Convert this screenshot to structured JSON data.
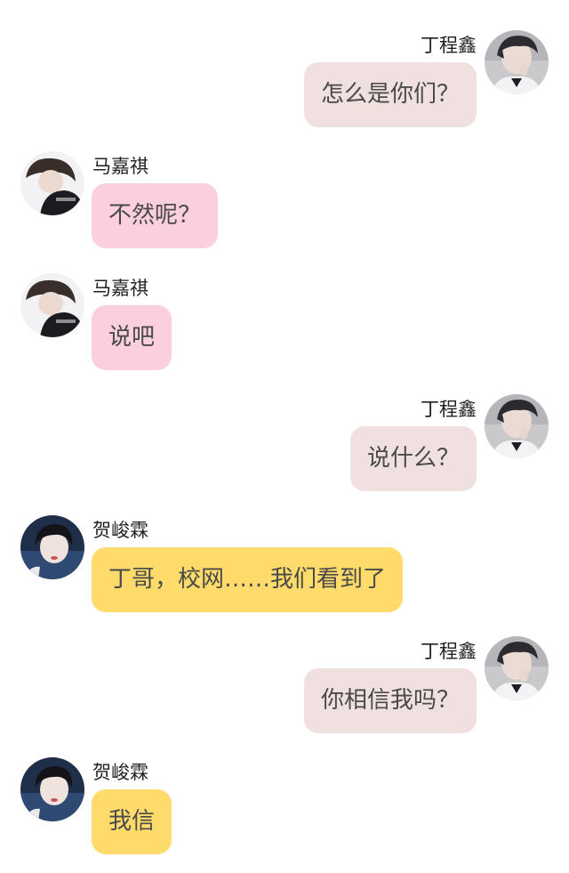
{
  "colors": {
    "bubble_dingchengxin": "#f1e0e0",
    "bubble_majiaqi": "#fbcfdb",
    "bubble_hejunlin": "#fedb6a",
    "text": "#4a4a4a",
    "background": "#ffffff"
  },
  "messages": [
    {
      "side": "right",
      "sender": "丁程鑫",
      "text": "怎么是你们？",
      "avatar": "avatar-dingchengxin"
    },
    {
      "side": "left",
      "sender": "马嘉祺",
      "text": "不然呢？",
      "avatar": "avatar-majiaqi"
    },
    {
      "side": "left",
      "sender": "马嘉祺",
      "text": "说吧",
      "avatar": "avatar-majiaqi"
    },
    {
      "side": "right",
      "sender": "丁程鑫",
      "text": "说什么？",
      "avatar": "avatar-dingchengxin"
    },
    {
      "side": "left",
      "sender": "贺峻霖",
      "text": "丁哥，校网……我们看到了",
      "avatar": "avatar-hejunlin"
    },
    {
      "side": "right",
      "sender": "丁程鑫",
      "text": "你相信我吗？",
      "avatar": "avatar-dingchengxin"
    },
    {
      "side": "left",
      "sender": "贺峻霖",
      "text": "我信",
      "avatar": "avatar-hejunlin"
    }
  ]
}
